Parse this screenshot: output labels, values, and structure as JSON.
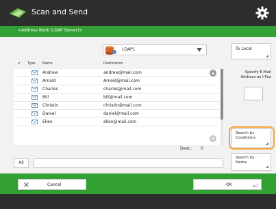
{
  "app": {
    "title": "Scan and Send",
    "subtitle": "<Address Book (LDAP Server)>"
  },
  "source": {
    "selected": "LDAP1"
  },
  "buttons": {
    "to_local": "To Local",
    "specify_label": "Specify E-Mail Address as I-Fax",
    "search_conditions_line1": "Search by",
    "search_conditions_line2": "Conditions",
    "search_name_line1": "Search by",
    "search_name_line2": "Name",
    "all": "All",
    "cancel": "Cancel",
    "ok": "OK"
  },
  "table": {
    "headers": {
      "check": "✔",
      "type": "Type",
      "name": "Name",
      "destination": "Destination"
    },
    "rows": [
      {
        "name": "Andrew",
        "destination": "andrew@mail.com"
      },
      {
        "name": "Arnold",
        "destination": "Arnold@mail.com"
      },
      {
        "name": "Charles",
        "destination": "charles@mail.com"
      },
      {
        "name": "Bill",
        "destination": "bill@mail.com"
      },
      {
        "name": "Christin",
        "destination": "christin@mail.com"
      },
      {
        "name": "Daniel",
        "destination": "daniel@mail.com"
      },
      {
        "name": "Ellen",
        "destination": "ellen@mail.com"
      }
    ]
  },
  "footer": {
    "dest_label": "Dest.:",
    "dest_count": "0"
  },
  "colors": {
    "title_bar": "#2e2e2e",
    "accent_green": "#33a033",
    "highlight_orange": "#f3a63c"
  }
}
